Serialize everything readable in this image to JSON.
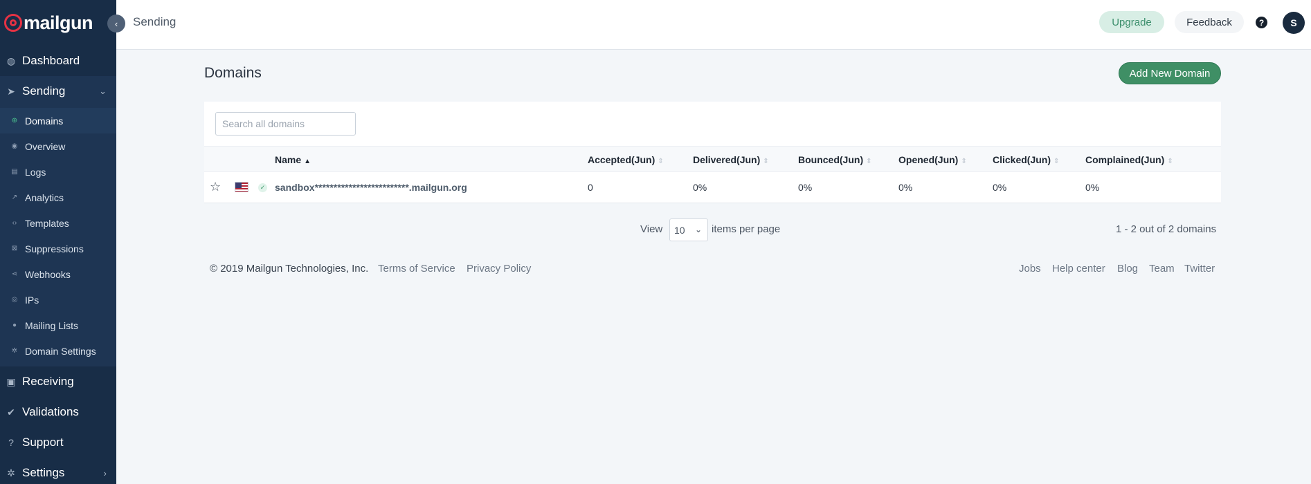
{
  "brand": {
    "name": "mailgun",
    "accent": "#e53244"
  },
  "sidebar": {
    "sections": [
      {
        "label": "Dashboard",
        "icon": "dashboard-icon"
      },
      {
        "label": "Sending",
        "icon": "paper-plane-icon"
      },
      {
        "label": "Receiving",
        "icon": "inbox-icon"
      },
      {
        "label": "Validations",
        "icon": "user-check-icon"
      },
      {
        "label": "Support",
        "icon": "question-circle-icon"
      },
      {
        "label": "Settings",
        "icon": "gear-icon"
      }
    ],
    "sending_items": [
      {
        "label": "Domains",
        "icon": "globe-icon"
      },
      {
        "label": "Overview",
        "icon": "eye-icon"
      },
      {
        "label": "Logs",
        "icon": "document-icon"
      },
      {
        "label": "Analytics",
        "icon": "trend-icon"
      },
      {
        "label": "Templates",
        "icon": "code-icon"
      },
      {
        "label": "Suppressions",
        "icon": "block-icon"
      },
      {
        "label": "Webhooks",
        "icon": "share-icon"
      },
      {
        "label": "IPs",
        "icon": "location-pin-icon"
      },
      {
        "label": "Mailing Lists",
        "icon": "person-icon"
      },
      {
        "label": "Domain Settings",
        "icon": "cog-icon"
      }
    ]
  },
  "topbar": {
    "breadcrumb": "Sending",
    "upgrade_label": "Upgrade",
    "feedback_label": "Feedback",
    "help_label": "?",
    "avatar_initial": "S"
  },
  "main": {
    "title": "Domains",
    "add_button_label": "Add New Domain",
    "search_placeholder": "Search all domains",
    "columns": [
      "Name",
      "Accepted(Jun)",
      "Delivered(Jun)",
      "Bounced(Jun)",
      "Opened(Jun)",
      "Clicked(Jun)",
      "Complained(Jun)"
    ],
    "rows": [
      {
        "domain": "sandbox*************************.mailgun.org",
        "accepted": "0",
        "delivered": "0%",
        "bounced": "0%",
        "opened": "0%",
        "clicked": "0%",
        "complained": "0%"
      }
    ],
    "pagination": {
      "view_label": "View",
      "per_page": "10",
      "items_label": "items per page",
      "count_text": "1 - 2 out of 2 domains"
    }
  },
  "footer": {
    "copyright": "© 2019 Mailgun Technologies, Inc.",
    "left_links": [
      "Terms of Service",
      "Privacy Policy"
    ],
    "right_links": [
      "Jobs",
      "Help center",
      "Blog",
      "Team",
      "Twitter"
    ]
  }
}
